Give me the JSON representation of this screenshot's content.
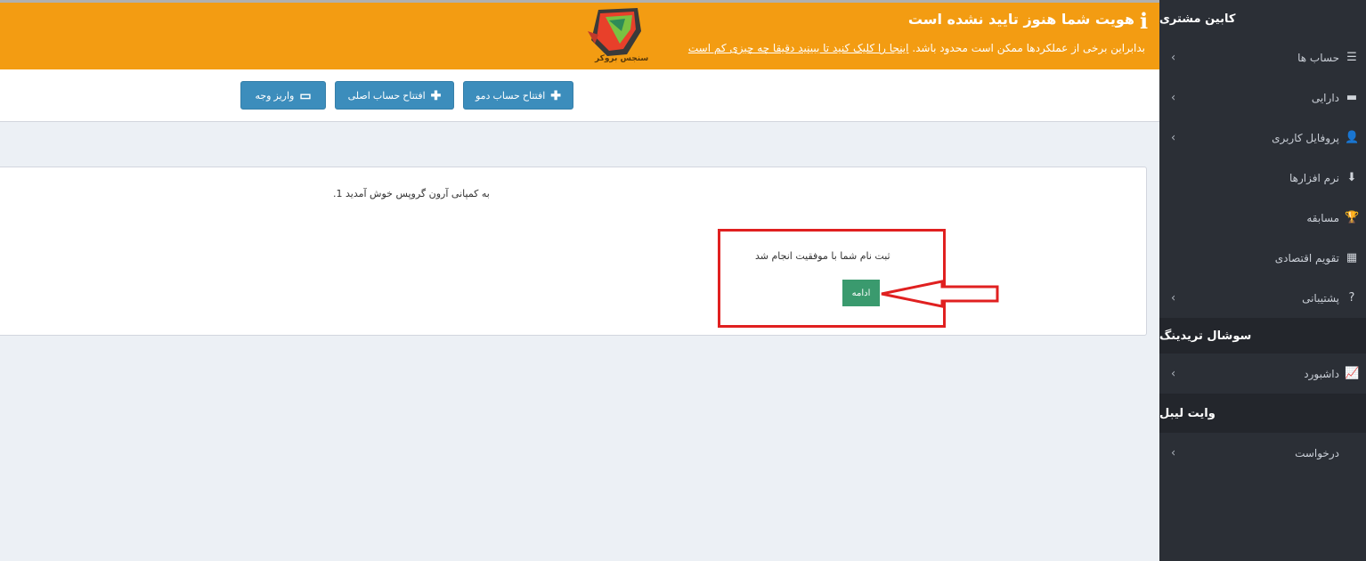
{
  "sidebar": {
    "header": "کابین مشتری",
    "items": [
      {
        "label": "حساب ها",
        "icon": "list-icon",
        "glyph": "☰",
        "has_chevron": true
      },
      {
        "label": "دارایی",
        "icon": "wallet-icon",
        "glyph": "▬",
        "has_chevron": true
      },
      {
        "label": "پروفایل کاربری",
        "icon": "user-icon",
        "glyph": "👤",
        "has_chevron": true
      },
      {
        "label": "نرم افزارها",
        "icon": "download-icon",
        "glyph": "⬇",
        "has_chevron": false
      },
      {
        "label": "مسابقه",
        "icon": "trophy-icon",
        "glyph": "🏆",
        "has_chevron": false
      },
      {
        "label": "تقویم اقتصادی",
        "icon": "calendar-icon",
        "glyph": "▦",
        "has_chevron": false
      },
      {
        "label": "پشتیبانی",
        "icon": "question-icon",
        "glyph": "?",
        "has_chevron": true
      }
    ],
    "social_section": "سوشال تریدینگ",
    "social_items": [
      {
        "label": "داشبورد",
        "icon": "chart-icon",
        "glyph": "📈",
        "has_chevron": true
      }
    ],
    "whitelabel_section": "وایت لیبل",
    "whitelabel_items": [
      {
        "label": "درخواست",
        "icon": "",
        "glyph": "",
        "has_chevron": true
      }
    ]
  },
  "alert": {
    "title": "هویت شما هنوز تایید نشده است",
    "text_prefix": "بدابراین برخی از عملکردها ممکن است محدود باشد.",
    "link_text": "اینجا را کلیک کنید تا ببینید دقیقا چه چیزی کم است",
    "logo_text": "سنجس بروکر",
    "color": "#f39c12"
  },
  "toolbar": {
    "open_demo": "افتتاح حساب دمو",
    "open_real": "افتتاح حساب اصلی",
    "deposit": "واریز وجه"
  },
  "main": {
    "welcome": "به کمپانی آرون گروپس خوش آمدید 1.",
    "success_message": "ثبت نام شما با موفقیت انجام شد",
    "continue_label": "ادامه"
  }
}
